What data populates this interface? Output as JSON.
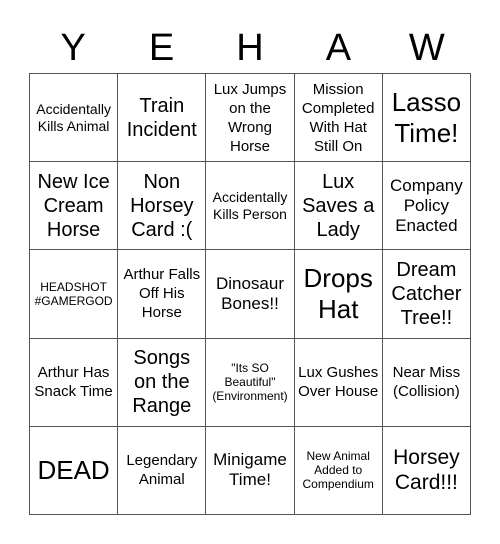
{
  "header": {
    "letters": [
      "Y",
      "E",
      "H",
      "A",
      "W"
    ]
  },
  "board": {
    "cells": [
      [
        "Accidentally Kills Animal",
        "Train Incident",
        "Lux Jumps on the Wrong Horse",
        "Mission Completed With Hat Still On",
        "Lasso Time!"
      ],
      [
        "New Ice Cream Horse",
        "Non Horsey Card :(",
        "Accidentally Kills Person",
        "Lux Saves a Lady",
        "Company Policy Enacted"
      ],
      [
        "HEADSHOT #GAMERGOD",
        "Arthur Falls Off His Horse",
        "Dinosaur Bones!!",
        "Drops Hat",
        "Dream Catcher Tree!!"
      ],
      [
        "Arthur Has Snack Time",
        "Songs on the Range",
        "\"Its SO Beautiful\" (Environment)",
        "Lux Gushes Over House",
        "Near Miss (Collision)"
      ],
      [
        "DEAD",
        "Legendary Animal",
        "Minigame Time!",
        "New Animal Added to Compendium",
        "Horsey Card!!!"
      ]
    ]
  }
}
